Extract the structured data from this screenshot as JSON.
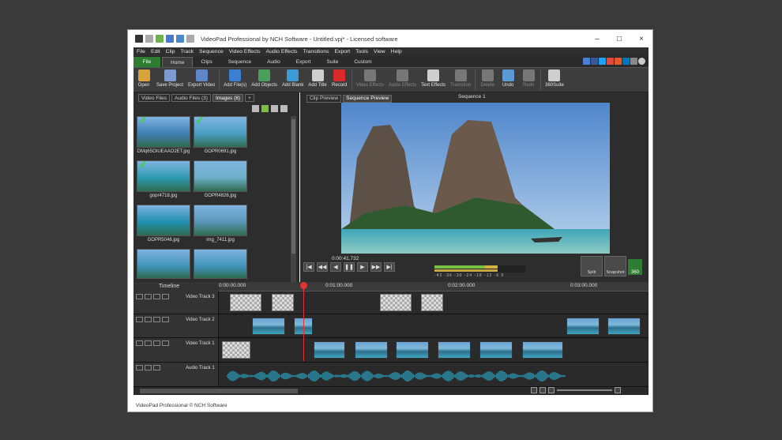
{
  "window": {
    "title": "VideoPad Professional by NCH Software - Untitled.vpj* - Licensed software",
    "controls": [
      "–",
      "□",
      "×"
    ]
  },
  "menu": [
    "File",
    "Edit",
    "Clip",
    "Track",
    "Sequence",
    "Video Effects",
    "Audio Effects",
    "Transitions",
    "Export",
    "Tools",
    "View",
    "Help"
  ],
  "ribbon_tabs": [
    "File",
    "Home",
    "Clips",
    "Sequence",
    "Audio",
    "Export",
    "Suite",
    "Custom"
  ],
  "ribbon_buttons": [
    {
      "label": "Open",
      "color": "#d9a33a",
      "enabled": true
    },
    {
      "label": "Save Project",
      "color": "#7b9bd1",
      "enabled": true
    },
    {
      "label": "Export Video",
      "color": "#5f86c9",
      "enabled": true
    },
    {
      "label": "Add File(s)",
      "color": "#3a7fd1",
      "enabled": true
    },
    {
      "label": "Add Objects",
      "color": "#4a9f5a",
      "enabled": true
    },
    {
      "label": "Add Blank",
      "color": "#3d9ad6",
      "enabled": true
    },
    {
      "label": "Add Title",
      "color": "#cfcfcf",
      "enabled": true
    },
    {
      "label": "Record",
      "color": "#d92b2b",
      "enabled": true
    },
    {
      "label": "Video Effects",
      "color": "#777",
      "enabled": false
    },
    {
      "label": "Audio Effects",
      "color": "#777",
      "enabled": false
    },
    {
      "label": "Text Effects",
      "color": "#cfcfcf",
      "enabled": true
    },
    {
      "label": "Transition",
      "color": "#777",
      "enabled": false
    },
    {
      "label": "Delete",
      "color": "#777",
      "enabled": false
    },
    {
      "label": "Undo",
      "color": "#5c9ad6",
      "enabled": true
    },
    {
      "label": "Redo",
      "color": "#777",
      "enabled": false
    },
    {
      "label": "360Suite",
      "color": "#cfcfcf",
      "enabled": true
    }
  ],
  "bin": {
    "tabs": [
      "Video Files",
      "Audio Files (3)",
      "Images (8)"
    ],
    "add_tab": "+",
    "items": [
      {
        "name": "DMq65OIUEAAO2ET.jpg",
        "checked": true
      },
      {
        "name": "GOPR0691.jpg",
        "checked": true
      },
      {
        "name": "gopr4718.jpg",
        "checked": true
      },
      {
        "name": "GOPR4826.jpg",
        "checked": false
      },
      {
        "name": "GOPR5046.jpg",
        "checked": false
      },
      {
        "name": "img_7411.jpg",
        "checked": false
      }
    ]
  },
  "preview": {
    "tabs": [
      "Clip Preview",
      "Sequence Preview"
    ],
    "sequence_title": "Sequence 1",
    "timecode": "0:00:41.732",
    "meter_scale": "-42  -36  -30  -24  -18  -12  -6   0",
    "split_label": "Split",
    "snapshot_label": "Snapshot",
    "b360_label": "360"
  },
  "timeline": {
    "label": "Timeline",
    "ruler": [
      "0:00:00.000",
      "0:01:00.000",
      "0:02:00.000",
      "0:03:00.000"
    ],
    "tracks": [
      "Video Track 3",
      "Video Track 2",
      "Video Track 1",
      "Audio Track 1"
    ]
  },
  "status": {
    "text": "VideoPad Professional © NCH Software"
  }
}
